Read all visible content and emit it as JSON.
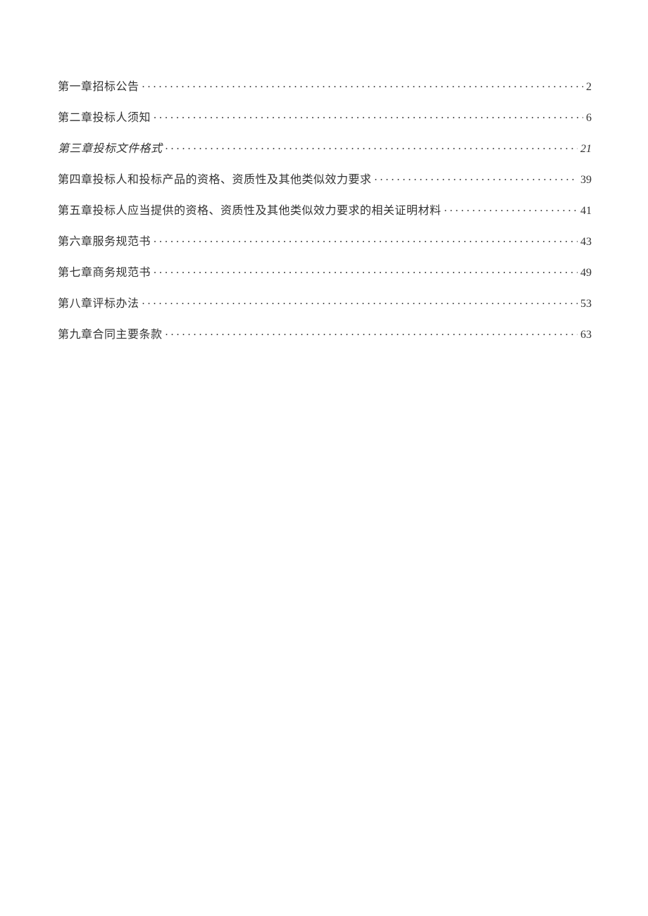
{
  "toc": [
    {
      "title": "第一章招标公告",
      "page": "2",
      "italic": false
    },
    {
      "title": "第二章投标人须知",
      "page": "6",
      "italic": false
    },
    {
      "title": "第三章投标文件格式",
      "page": "21",
      "italic": true
    },
    {
      "title": "第四章投标人和投标产品的资格、资质性及其他类似效力要求",
      "page": "39",
      "italic": false
    },
    {
      "title": "第五章投标人应当提供的资格、资质性及其他类似效力要求的相关证明材料",
      "page": "41",
      "italic": false
    },
    {
      "title": "第六章服务规范书",
      "page": "43",
      "italic": false
    },
    {
      "title": "第七章商务规范书",
      "page": "49",
      "italic": false
    },
    {
      "title": "第八章评标办法",
      "page": "53",
      "italic": false
    },
    {
      "title": "第九章合同主要条款",
      "page": "63",
      "italic": false
    }
  ]
}
